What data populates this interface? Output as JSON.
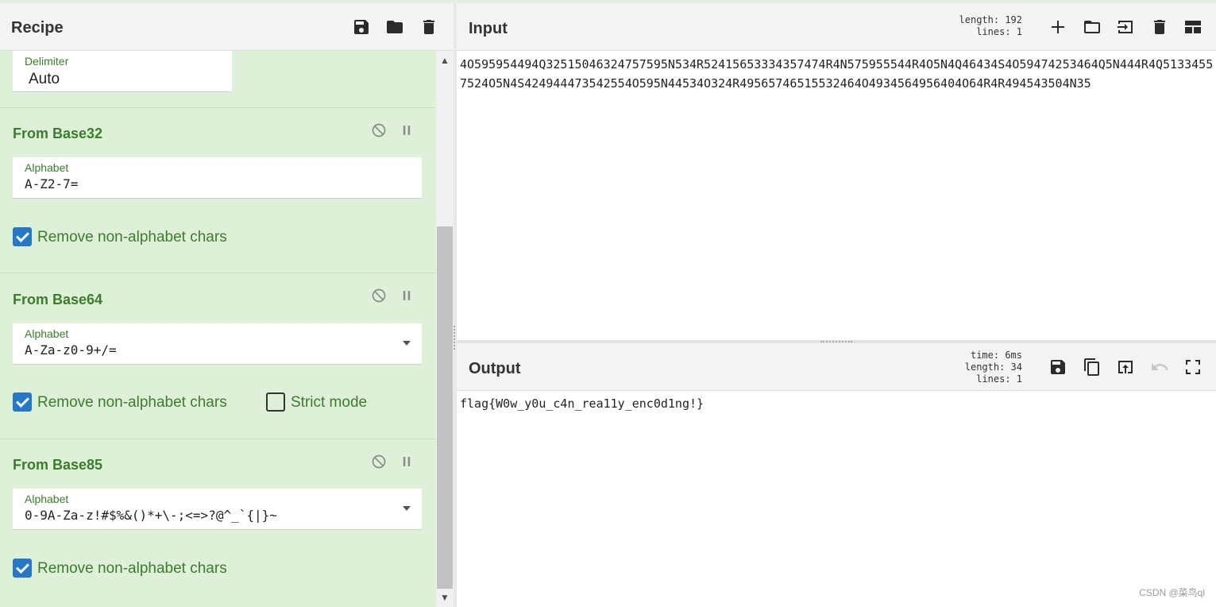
{
  "recipe": {
    "title": "Recipe",
    "toolbar_icons": [
      "save-icon",
      "folder-icon",
      "trash-icon"
    ],
    "delimiter": {
      "label": "Delimiter",
      "value": "Auto"
    },
    "operations": [
      {
        "title": "From Base32",
        "alphabet_label": "Alphabet",
        "alphabet_value": "A-Z2-7=",
        "has_dropdown": false,
        "options": [
          {
            "label": "Remove non-alphabet chars",
            "checked": true
          }
        ]
      },
      {
        "title": "From Base64",
        "alphabet_label": "Alphabet",
        "alphabet_value": "A-Za-z0-9+/=",
        "has_dropdown": true,
        "options": [
          {
            "label": "Remove non-alphabet chars",
            "checked": true
          },
          {
            "label": "Strict mode",
            "checked": false
          }
        ]
      },
      {
        "title": "From Base85",
        "alphabet_label": "Alphabet",
        "alphabet_value": "0-9A-Za-z!#$%&()*+\\-;<=>?@^_`{|}~",
        "has_dropdown": true,
        "options": [
          {
            "label": "Remove non-alphabet chars",
            "checked": true
          }
        ]
      }
    ]
  },
  "input": {
    "title": "Input",
    "stats_line1": "length: 192",
    "stats_line2": "lines:   1",
    "text": "4O595954494Q32515046324757595N534R52415653334357474R4N575955544R4O5N4Q46434S4O59474253464Q5N444R4Q51334557524O5N4S424944473542554O595N44534O324R49565746515532464O4934564956404O64R4R494543504N35",
    "toolbar_icons": [
      "plus-icon",
      "folder-icon",
      "import-icon",
      "trash-icon",
      "layout-icon"
    ]
  },
  "output": {
    "title": "Output",
    "stats_line1": "time:  6ms",
    "stats_line2": "length:  34",
    "stats_line3": "lines:   1",
    "text": "flag{W0w_y0u_c4n_rea11y_enc0d1ng!}",
    "toolbar_icons": [
      "save-icon",
      "copy-icon",
      "replace-input-icon",
      "undo-icon",
      "fullscreen-icon"
    ]
  },
  "watermark": "CSDN @菜鸟ql",
  "colors": {
    "op_background": "#dff0d8",
    "op_title": "#3a7d2c",
    "checkbox": "#2477c9"
  }
}
